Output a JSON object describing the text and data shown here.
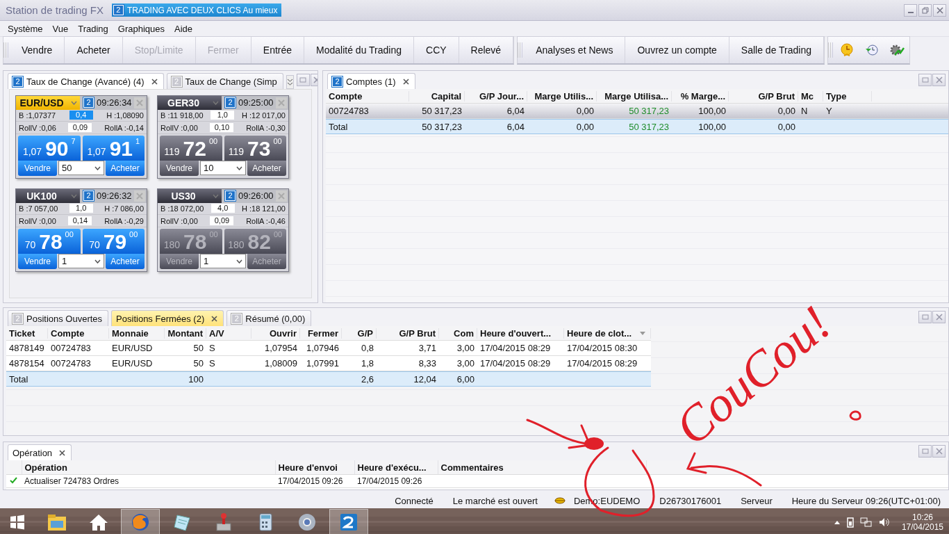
{
  "window": {
    "title": "Station de trading FX",
    "badge": "2",
    "banner": "TRADING AVEC DEUX CLICS Au mieux"
  },
  "menu": [
    "Système",
    "Vue",
    "Trading",
    "Graphiques",
    "Aide"
  ],
  "toolbar": {
    "groups": [
      [
        {
          "label": "Vendre",
          "disabled": false
        },
        {
          "label": "Acheter",
          "disabled": false
        },
        {
          "label": "Stop/Limite",
          "disabled": true
        },
        {
          "label": "Fermer",
          "disabled": true
        },
        {
          "label": "Entrée",
          "disabled": false
        },
        {
          "label": "Modalité du Trading",
          "disabled": false
        },
        {
          "label": "CCY",
          "disabled": false
        },
        {
          "label": "Relevé",
          "disabled": false
        }
      ],
      [
        {
          "label": "Analyses et News",
          "disabled": false
        },
        {
          "label": "Ouvrez un compte",
          "disabled": false
        },
        {
          "label": "Salle de Trading",
          "disabled": false
        }
      ]
    ],
    "icons": [
      {
        "kind": "alarm"
      },
      {
        "kind": "history"
      },
      {
        "kind": "settings"
      }
    ]
  },
  "rates_panel": {
    "tabs": [
      {
        "badge": "2",
        "label": "Taux de Change (Avancé) (4)",
        "selected": true,
        "closable": true
      },
      {
        "badge": "2",
        "label": "Taux de Change (Simp",
        "selected": false,
        "closable": false
      }
    ],
    "tiles": [
      {
        "symbol": "EUR/USD",
        "highlighted": true,
        "badge": "2",
        "time": "09:26:34",
        "b": "B :1,07377",
        "spread": "0,4",
        "spread_highlighted": true,
        "h": "H :1,08090",
        "rollv": "RollV :0,06",
        "roll": "0,09",
        "rolla": "RollA :-0,14",
        "kind": "active",
        "sell": {
          "prefix": "1,07",
          "big": "90",
          "sup": "7"
        },
        "buy": {
          "prefix": "1,07",
          "big": "91",
          "sup": "1"
        },
        "sell_label": "Vendre",
        "qty": "50",
        "buy_label": "Acheter"
      },
      {
        "symbol": "GER30",
        "highlighted": false,
        "badge": "2",
        "time": "09:25:00",
        "b": "B :11 918,00",
        "spread": "1,0",
        "spread_highlighted": false,
        "h": "H :12 017,00",
        "rollv": "RollV :0,00",
        "roll": "0,10",
        "rolla": "RollA :-0,30",
        "kind": "inactive",
        "sell": {
          "prefix": "119",
          "big": "72",
          "sup": "00"
        },
        "buy": {
          "prefix": "119",
          "big": "73",
          "sup": "00"
        },
        "sell_label": "Vendre",
        "qty": "10",
        "buy_label": "Acheter"
      },
      {
        "symbol": "UK100",
        "highlighted": false,
        "badge": "2",
        "time": "09:26:32",
        "b": "B :7 057,00",
        "spread": "1,0",
        "spread_highlighted": false,
        "h": "H :7 086,00",
        "rollv": "RollV :0,00",
        "roll": "0,14",
        "rolla": "RollA :-0,29",
        "kind": "active",
        "sell": {
          "prefix": "70",
          "big": "78",
          "sup": "00"
        },
        "buy": {
          "prefix": "70",
          "big": "79",
          "sup": "00"
        },
        "sell_label": "Vendre",
        "qty": "1",
        "buy_label": "Acheter"
      },
      {
        "symbol": "US30",
        "highlighted": false,
        "badge": "2",
        "time": "09:26:00",
        "b": "B :18 072,00",
        "spread": "4,0",
        "spread_highlighted": false,
        "h": "H :18 121,00",
        "rollv": "RollV :0,00",
        "roll": "0,09",
        "rolla": "RollA :-0,46",
        "kind": "dimmed",
        "sell": {
          "prefix": "180",
          "big": "78",
          "sup": "00"
        },
        "buy": {
          "prefix": "180",
          "big": "82",
          "sup": "00"
        },
        "sell_label": "Vendre",
        "qty": "1",
        "buy_label": "Acheter"
      }
    ]
  },
  "accounts_panel": {
    "tab": {
      "badge": "2",
      "label": "Comptes (1)",
      "selected": true
    },
    "columns": [
      {
        "label": "Compte",
        "positive": false
      },
      {
        "label": "Capital",
        "positive": false
      },
      {
        "label": "G/P Jour...",
        "positive": false
      },
      {
        "label": "Marge Utilis...",
        "positive": false
      },
      {
        "label": "Marge Utilisa...",
        "positive": true
      },
      {
        "label": "% Marge...",
        "positive": false
      },
      {
        "label": "G/P Brut",
        "positive": false
      },
      {
        "label": "Mc",
        "positive": false
      },
      {
        "label": "Type",
        "positive": false
      }
    ],
    "rows": [
      {
        "kind": "row",
        "selected": true,
        "cells": [
          "00724783",
          "50 317,23",
          "6,04",
          "0,00",
          "50 317,23",
          "100,00",
          "0,00",
          "N",
          "Y"
        ]
      },
      {
        "kind": "total",
        "selected": false,
        "cells": [
          "Total",
          "50 317,23",
          "6,04",
          "0,00",
          "50 317,23",
          "100,00",
          "0,00",
          "",
          ""
        ]
      }
    ]
  },
  "positions_panel": {
    "tabs": [
      {
        "badge": "2",
        "label": "Positions Ouvertes",
        "selected": false,
        "closable": false
      },
      {
        "label": "Positions Fermées (2)",
        "selected": true,
        "closable": true
      },
      {
        "badge": "2",
        "label": "Résumé (0,00)",
        "selected": false,
        "closable": false
      }
    ],
    "columns": [
      {
        "label": "Ticket",
        "sorted": false
      },
      {
        "label": "Compte",
        "sorted": false
      },
      {
        "label": "Monnaie",
        "sorted": false
      },
      {
        "label": "Montant",
        "sorted": false
      },
      {
        "label": "A/V",
        "sorted": false
      },
      {
        "label": "Ouvrir",
        "sorted": false
      },
      {
        "label": "Fermer",
        "sorted": false
      },
      {
        "label": "G/P",
        "sorted": false
      },
      {
        "label": "G/P Brut",
        "sorted": false
      },
      {
        "label": "Com",
        "sorted": false
      },
      {
        "label": "Heure d'ouvert...",
        "sorted": false
      },
      {
        "label": "Heure de clot...",
        "sorted": true
      }
    ],
    "rows": [
      {
        "kind": "row",
        "cells": [
          "4878149",
          "00724783",
          "EUR/USD",
          "50",
          "S",
          "1,07954",
          "1,07946",
          "0,8",
          "3,71",
          "3,00",
          "17/04/2015 08:29",
          "17/04/2015 08:30"
        ]
      },
      {
        "kind": "row",
        "cells": [
          "4878154",
          "00724783",
          "EUR/USD",
          "50",
          "S",
          "1,08009",
          "1,07991",
          "1,8",
          "8,33",
          "3,00",
          "17/04/2015 08:29",
          "17/04/2015 08:29"
        ]
      },
      {
        "kind": "total",
        "cells": [
          "Total",
          "",
          "",
          "100",
          "",
          "",
          "",
          "2,6",
          "12,04",
          "6,00",
          "",
          ""
        ]
      }
    ]
  },
  "operations_panel": {
    "tab": {
      "label": "Opération",
      "selected": true
    },
    "columns": [
      "Opération",
      "Heure d'envoi",
      "Heure d'exécu...",
      "Commentaires"
    ],
    "rows": [
      {
        "cells": [
          "Actualiser 724783 Ordres",
          "17/04/2015 09:26",
          "17/04/2015 09:26",
          ""
        ]
      }
    ]
  },
  "status_bar": [
    {
      "kind": "text",
      "text": "Connecté"
    },
    {
      "kind": "text",
      "text": "Le marché est ouvert"
    },
    {
      "kind": "server",
      "text": "Demo:EUDEMO"
    },
    {
      "kind": "text",
      "text": "D26730176001"
    },
    {
      "kind": "text",
      "text": "Serveur"
    },
    {
      "kind": "text",
      "text": "Heure du Serveur 09:26(UTC+01:00)"
    }
  ],
  "annotation": {
    "text": "CouCou!"
  },
  "taskbar": {
    "apps": [
      {
        "kind": "files",
        "selected": false
      },
      {
        "kind": "home",
        "selected": false
      },
      {
        "kind": "browser",
        "selected": true
      },
      {
        "kind": "notes",
        "selected": false
      },
      {
        "kind": "installer",
        "selected": false
      },
      {
        "kind": "calculator",
        "selected": false
      },
      {
        "kind": "globe",
        "selected": false
      },
      {
        "kind": "trading",
        "selected": true
      }
    ],
    "time": "10:26",
    "date": "17/04/2015"
  }
}
